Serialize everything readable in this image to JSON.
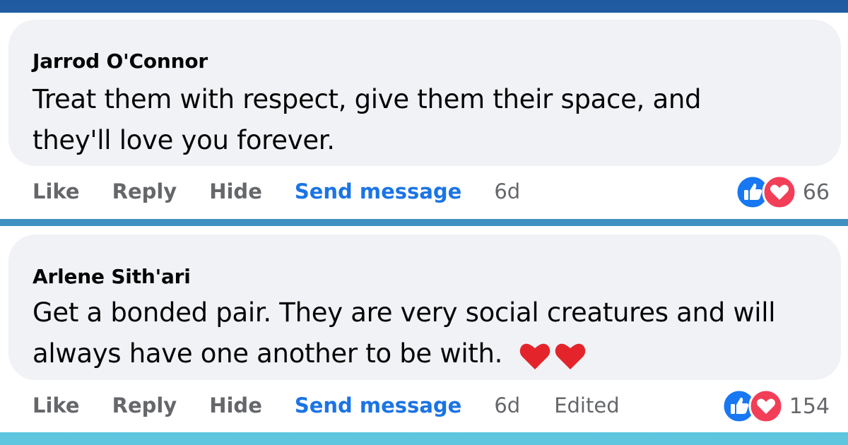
{
  "comments": [
    {
      "author": "Jarrod O'Connor",
      "text_lines": [
        "Treat them with respect, give them their space, and",
        "they'll love you forever."
      ],
      "actions": {
        "like": "Like",
        "reply": "Reply",
        "hide": "Hide",
        "send": "Send message"
      },
      "time": "6d",
      "edited": "",
      "reaction_icons": [
        "like-icon",
        "love-icon"
      ],
      "reaction_count": "66",
      "trailing_emoji": ""
    },
    {
      "author": "Arlene Sith'ari",
      "text_lines": [
        "Get a bonded pair. They are very social creatures and will",
        "always have one another to be with."
      ],
      "actions": {
        "like": "Like",
        "reply": "Reply",
        "hide": "Hide",
        "send": "Send message"
      },
      "time": "6d",
      "edited": "Edited",
      "reaction_icons": [
        "like-icon",
        "love-icon"
      ],
      "reaction_count": "154",
      "trailing_emoji": "heart-emoji-x2"
    }
  ],
  "colors": {
    "bubble": "#f0f2f5",
    "link_blue": "#1b74e4",
    "muted": "#65676b",
    "like_blue": "#1877f2",
    "love_red": "#f33e58"
  }
}
